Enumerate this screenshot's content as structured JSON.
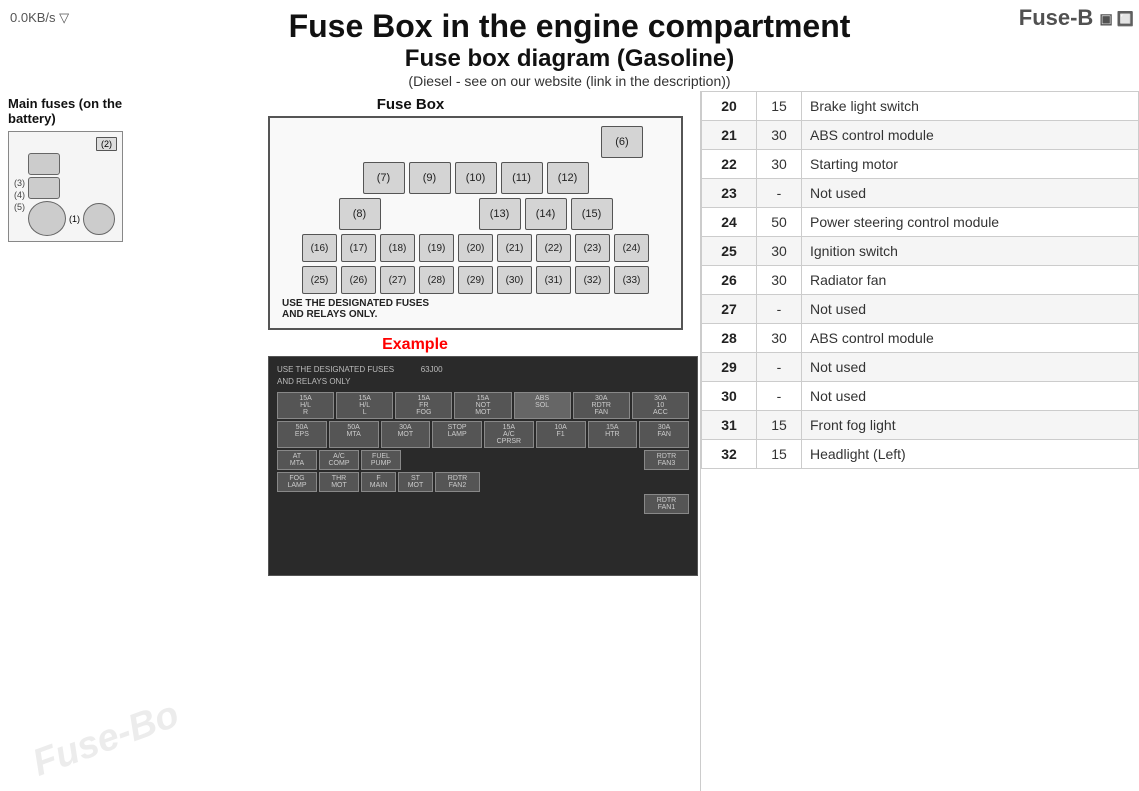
{
  "header": {
    "title": "Fuse Box in the engine compartment",
    "subtitle": "Fuse box diagram (Gasoline)",
    "note": "(Diesel - see on our website (link in the description))",
    "speed": "0.0KB/s ▽"
  },
  "logo": "Fuse-B",
  "left_panel": {
    "main_fuses_label": "Main fuses (on the battery)",
    "fuse_box_label": "Fuse Box",
    "battery_fuse_labels": [
      "(2)",
      "(3)",
      "(4)",
      "(5)",
      "(1)"
    ],
    "fuse_rows": [
      {
        "cells": [
          "(6)"
        ]
      },
      {
        "cells": [
          "(7)",
          "(9)",
          "(10)",
          "(11)",
          "(12)"
        ]
      },
      {
        "cells": [
          "(8)",
          "",
          "(13)",
          "(14)",
          "(15)"
        ]
      },
      {
        "cells": [
          "(16)",
          "(17)",
          "(18)",
          "(19)",
          "(20)",
          "(21)",
          "(22)",
          "(23)",
          "(24)"
        ]
      },
      {
        "cells": [
          "(25)",
          "(26)",
          "(27)",
          "(28)",
          "(29)",
          "(30)",
          "(31)",
          "(32)",
          "(33)"
        ]
      }
    ],
    "fuse_note": "USE THE DESIGNATED FUSES\nAND RELAYS ONLY.",
    "example_label": "Example"
  },
  "table": {
    "rows": [
      {
        "num": "20",
        "amp": "15",
        "desc": "Brake light switch"
      },
      {
        "num": "21",
        "amp": "30",
        "desc": "ABS control module"
      },
      {
        "num": "22",
        "amp": "30",
        "desc": "Starting motor"
      },
      {
        "num": "23",
        "amp": "-",
        "desc": "Not used"
      },
      {
        "num": "24",
        "amp": "50",
        "desc": "Power steering control module"
      },
      {
        "num": "25",
        "amp": "30",
        "desc": "Ignition switch"
      },
      {
        "num": "26",
        "amp": "30",
        "desc": "Radiator fan"
      },
      {
        "num": "27",
        "amp": "-",
        "desc": "Not used"
      },
      {
        "num": "28",
        "amp": "30",
        "desc": "ABS control module"
      },
      {
        "num": "29",
        "amp": "-",
        "desc": "Not used"
      },
      {
        "num": "30",
        "amp": "-",
        "desc": "Not used"
      },
      {
        "num": "31",
        "amp": "15",
        "desc": "Front fog light"
      },
      {
        "num": "32",
        "amp": "15",
        "desc": "Headlight (Left)"
      }
    ]
  },
  "example_rows": [
    {
      "cells": [
        "USE THE DESIGNATED FUSES",
        "",
        "63J00"
      ]
    },
    {
      "cells": [
        "AND RELAYS ONLY",
        "",
        ""
      ]
    },
    {
      "cells": [
        "15A",
        "15A",
        "15A",
        "15A",
        "ABS",
        "30A",
        "30A"
      ]
    },
    {
      "cells": [
        "H/L",
        "H/L",
        "FR",
        "NOT",
        "SOL",
        "RDTR",
        "10"
      ]
    },
    {
      "cells": [
        "R",
        "L",
        "FOG",
        "MOT",
        "",
        "FAN",
        "ACC"
      ]
    },
    {
      "cells": [
        "50A",
        "50A",
        "30A",
        "15A",
        "15A",
        "10A",
        "15A",
        "30A"
      ]
    },
    {
      "cells": [
        "EPS",
        "MTA",
        "MOT",
        "STOP",
        "A/C",
        "F1",
        "HTR",
        "FAN"
      ]
    },
    {
      "cells": [
        "AT",
        "A/C",
        "FUEL",
        "",
        "RDTR"
      ]
    },
    {
      "cells": [
        "MTA",
        "COMP",
        "PUMP",
        "",
        "FAN3"
      ]
    },
    {
      "cells": [
        "FOG",
        "THR",
        "F",
        "ST",
        "RDTR"
      ]
    },
    {
      "cells": [
        "LAMP",
        "MOT",
        "MAIN",
        "MOT",
        "FAN2"
      ]
    },
    {
      "cells": [
        "",
        "",
        "",
        "",
        "RDTR"
      ]
    },
    {
      "cells": [
        "",
        "",
        "",
        "",
        "FAN1"
      ]
    }
  ]
}
